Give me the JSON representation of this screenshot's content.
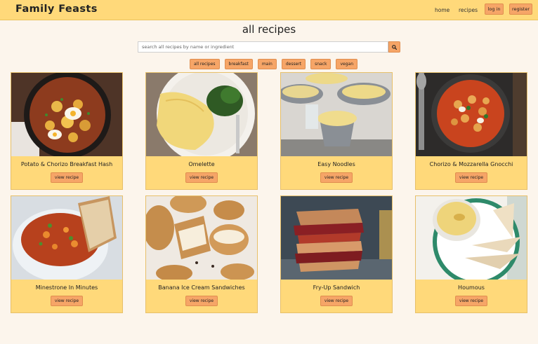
{
  "header": {
    "brand": "Family Feasts",
    "nav": {
      "home": "home",
      "recipes": "recipes",
      "login": "log in",
      "register": "register"
    }
  },
  "page": {
    "title": "all recipes"
  },
  "search": {
    "placeholder": "search all recipes by name or ingredient",
    "value": "",
    "icon": "search-icon"
  },
  "filters": [
    "all recipes",
    "breakfast",
    "main",
    "dessert",
    "snack",
    "vegan"
  ],
  "recipes": [
    {
      "title": "Potato & Chorizo Breakfast Hash",
      "button": "view recipe"
    },
    {
      "title": "Omelette",
      "button": "view recipe"
    },
    {
      "title": "Easy Noodles",
      "button": "view recipe"
    },
    {
      "title": "Chorizo & Mozzarella Gnocchi",
      "button": "view recipe"
    },
    {
      "title": "Minestrone In Minutes",
      "button": "view recipe"
    },
    {
      "title": "Banana Ice Cream Sandwiches",
      "button": "view recipe"
    },
    {
      "title": "Fry-Up Sandwich",
      "button": "view recipe"
    },
    {
      "title": "Houmous",
      "button": "view recipe"
    }
  ],
  "colors": {
    "navbar": "#ffd97a",
    "accent": "#f6a567",
    "background": "#fcf5ec",
    "card": "#ffd97a"
  }
}
